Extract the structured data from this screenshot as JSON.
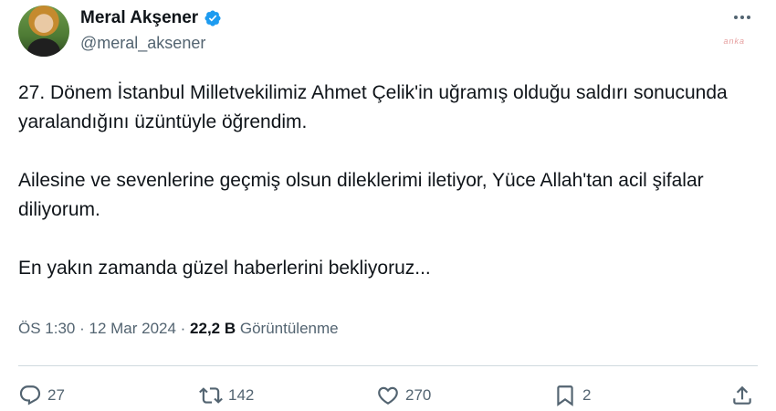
{
  "author": {
    "display_name": "Meral Akşener",
    "handle": "@meral_aksener",
    "verified": true
  },
  "watermark": "anka",
  "tweet": {
    "paragraphs": [
      "27. Dönem İstanbul Milletvekilimiz Ahmet Çelik'in uğramış olduğu saldırı sonucunda yaralandığını üzüntüyle öğrendim.",
      "Ailesine ve sevenlerine geçmiş olsun dileklerimi iletiyor, Yüce Allah'tan acil şifalar diliyorum.",
      "En yakın zamanda güzel haberlerini bekliyoruz..."
    ]
  },
  "meta": {
    "time": "ÖS 1:30",
    "separator": " · ",
    "date": "12 Mar 2024",
    "views_count": "22,2 B",
    "views_label": "Görüntülenme"
  },
  "actions": {
    "reply_count": "27",
    "retweet_count": "142",
    "like_count": "270",
    "bookmark_count": "2"
  },
  "colors": {
    "text": "#0f1419",
    "secondary": "#536471",
    "verified": "#1d9bf0",
    "divider": "#cfd9de"
  },
  "icons": [
    "more-icon",
    "verified-badge-icon",
    "reply-icon",
    "retweet-icon",
    "like-icon",
    "bookmark-icon",
    "share-icon"
  ]
}
